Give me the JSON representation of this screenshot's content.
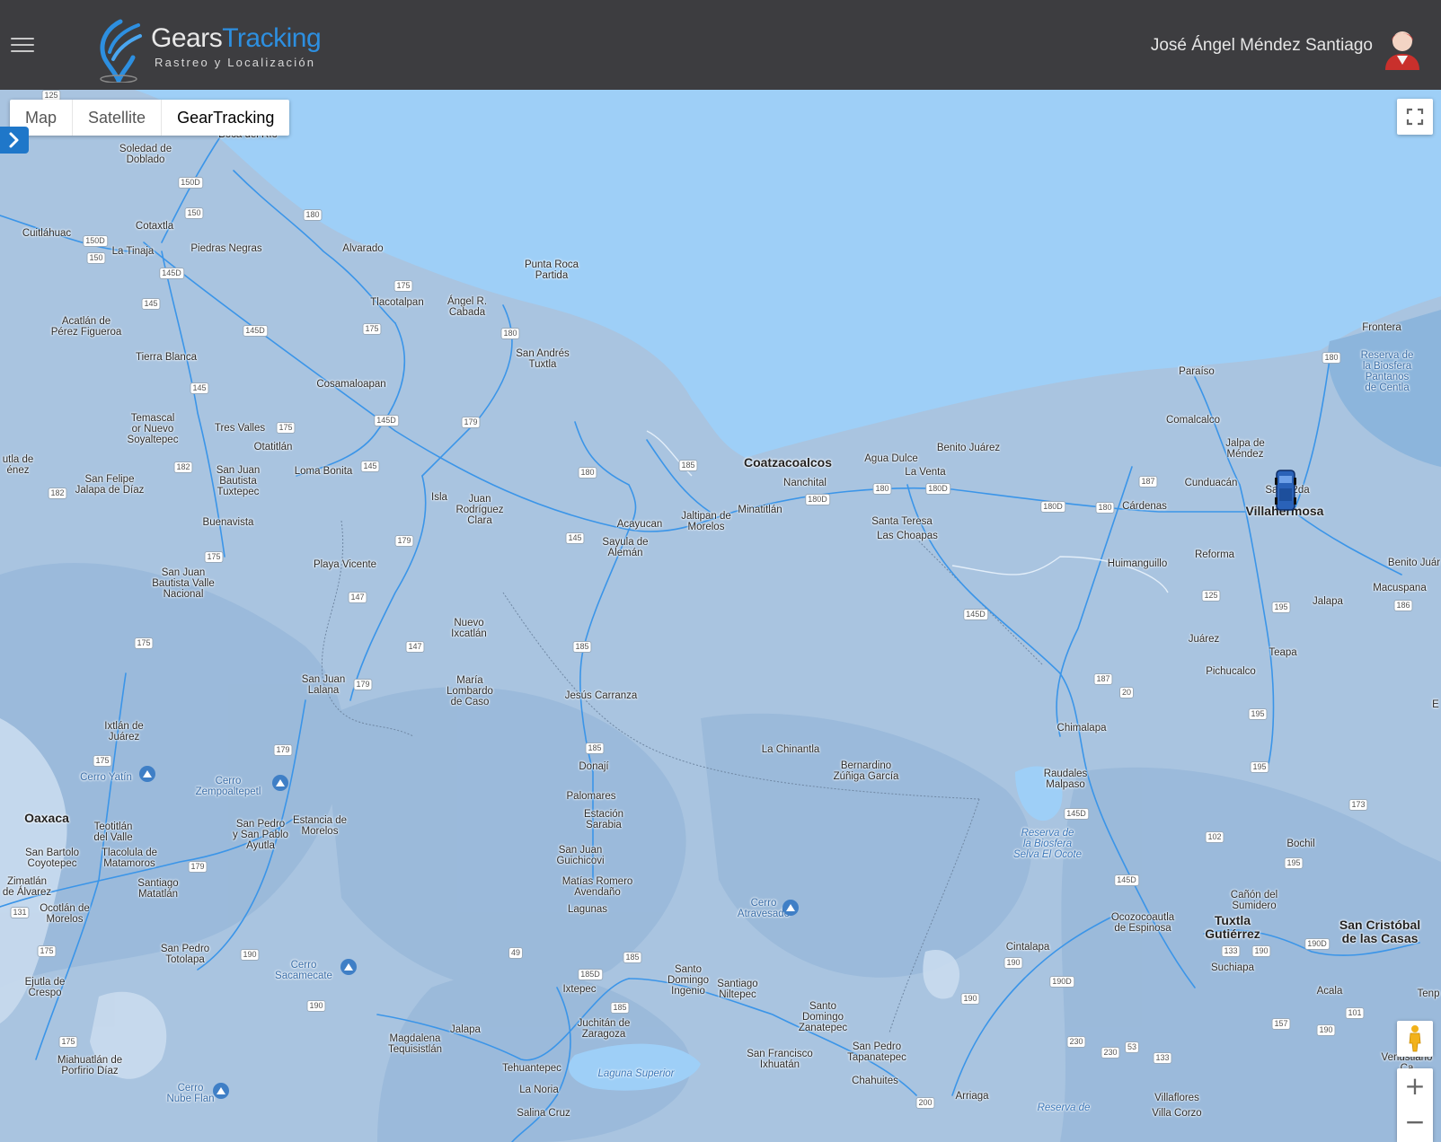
{
  "header": {
    "menu_icon": "hamburger-menu-icon",
    "logo_word1": "Gears",
    "logo_word2": "Tracking",
    "logo_tagline": "Rastreo y Localización",
    "user_name": "José Ángel Méndez Santiago",
    "avatar_icon": "user-avatar-icon"
  },
  "map_type": {
    "options": [
      "Map",
      "Satellite",
      "GearTracking"
    ],
    "selected": "GearTracking"
  },
  "controls": {
    "side_toggle_icon": "chevron-right-icon",
    "fullscreen_icon": "fullscreen-icon",
    "street_view_icon": "pegman-icon",
    "zoom_in": "+",
    "zoom_out": "−"
  },
  "colors": {
    "header_bg": "#3d3d40",
    "brand_blue": "#2d8fe0",
    "water": "#9ecff7",
    "land": "#a9c4e0",
    "road": "#3b95e8"
  },
  "places": {
    "boca_del_rio": "Boca del Río",
    "soledad": "Soledad de\nDoblado",
    "cotaxtla": "Cotaxtla",
    "cuitlahuac": "Cuitláhuac",
    "la_tinaja": "La Tinaja",
    "piedras_negras": "Piedras Negras",
    "alvarado": "Alvarado",
    "punta_roca": "Punta Roca\nPartida",
    "tlacotalpan": "Tlacotalpan",
    "angel_cabada": "Ángel R.\nCabada",
    "acatlan": "Acatlán de\nPérez Figueroa",
    "tierra_blanca": "Tierra Blanca",
    "san_andres": "San Andrés\nTuxtla",
    "cosamaloapan": "Cosamaloapan",
    "temascal": "Temascal\nor Nuevo\nSoyaltepec",
    "tres_valles": "Tres Valles",
    "otatitlan": "Otatitlán",
    "utla": "utla de\nénez",
    "san_felipe": "San Felipe\nJalapa de Díaz",
    "sj_tuxtepec": "San Juan\nBautista\nTuxtepec",
    "loma_bonita": "Loma Bonita",
    "isla": "Isla",
    "juan_rodriguez": "Juan\nRodríguez\nClara",
    "acayucan": "Acayucan",
    "sayula": "Sayula de\nAlemán",
    "jaltipan": "Jaltipan de\nMorelos",
    "minatitlan": "Minatitlán",
    "coatzacoalcos": "Coatzacoalcos",
    "nanchital": "Nanchital",
    "agua_dulce": "Agua Dulce",
    "la_venta": "La Venta",
    "benito_juarez": "Benito Juárez",
    "santa_teresa": "Santa Teresa",
    "las_choapas": "Las Choapas",
    "paraiso": "Paraíso",
    "comalcalco": "Comalcalco",
    "frontera": "Frontera",
    "centla": "Reserva de\nla Biosfera\nPantanos\nde Centla",
    "jalpa": "Jalpa de\nMéndez",
    "cunduacan": "Cunduacán",
    "cardenas": "Cárdenas",
    "villahermosa": "Villahermosa",
    "sa_2da": "Sa     2da",
    "buenavista": "Buenavista",
    "sj_valle": "San Juan\nBautista Valle\nNacional",
    "playa_vicente": "Playa Vicente",
    "nuevo_ixcatlan": "Nuevo\nIxcatlán",
    "maria_lombardo": "María\nLombardo\nde Caso",
    "jesus_carranza": "Jesús Carranza",
    "sj_lalana": "San Juan\nLalana",
    "huimanguillo": "Huimanguillo",
    "reforma": "Reforma",
    "benito_juarez2": "Benito Juár",
    "macuspana": "Macuspana",
    "jalapa_tab": "Jalapa",
    "juarez": "Juárez",
    "teapa": "Teapa",
    "pichucalco": "Pichucalco",
    "ixtlan": "Ixtlán de\nJuárez",
    "cerro_yatin": "Cerro Yatín",
    "cerro_zempoal": "Cerro\nZempoaltepetl",
    "la_chinantla": "La Chinantla",
    "bernardino": "Bernardino\nZúñiga García",
    "chimalapa": "Chimalapa",
    "raudales": "Raudales\nMalpaso",
    "donaji": "Donají",
    "palomares": "Palomares",
    "estacion_sarabia": "Estación\nSarabia",
    "oaxaca": "Oaxaca",
    "teotitlan": "Teotitlán\ndel Valle",
    "sp_ayutla": "San Pedro\ny San Pablo\nAyutla",
    "estancia": "Estancia de\nMorelos",
    "sj_guichicovi": "San Juan\nGuichicovi",
    "el_ocote": "Reserva de\nla Biosfera\nSelva El Ocote",
    "bochil": "Bochil",
    "sb_coyotepec": "San Bartolo\nCoyotepec",
    "tlacolula": "Tlacolula de\nMatamoros",
    "zimatlan": "Zimatlán\nde Álvarez",
    "santiago_matatlan": "Santiago\nMatatlán",
    "matias_romero": "Matías Romero\nAvendaño",
    "ocotlan": "Ocotlán de\nMorelos",
    "lagunas": "Lagunas",
    "cerro_atravesado": "Cerro\nAtravesado",
    "canon_sumidero": "Cañón del\nSumidero",
    "ocozocoautla": "Ocozocoautla\nde Espinosa",
    "tuxtla": "Tuxtla\nGutiérrez",
    "san_cristobal": "San Cristóbal\nde las Casas",
    "sp_totolapa": "San Pedro\nTotolapa",
    "cerro_sacamecate": "Cerro\nSacamecate",
    "ejutla": "Ejutla de\nCrespo",
    "cintalapa": "Cintalapa",
    "suchiapa": "Suchiapa",
    "ixtepec": "Ixtepec",
    "santo_domingo_ing": "Santo\nDomingo\nIngenio",
    "santiago_niltepec": "Santiago\nNiltepec",
    "acala": "Acala",
    "juchitan": "Juchitán de\nZaragoza",
    "santo_domingo_zan": "Santo\nDomingo\nZanatepec",
    "jalapa": "Jalapa",
    "magdalena": "Magdalena\nTequisistlán",
    "miahuatlan": "Miahuatlán de\nPorfirio Díaz",
    "sp_tapanatepec": "San Pedro\nTapanatepec",
    "sf_ixhuatan": "San Francisco\nIxhuatán",
    "tehuantepec": "Tehuantepec",
    "laguna_superior": "Laguna Superior",
    "cerro_nube": "Cerro\nNube Flan",
    "la_noria": "La Noria",
    "chahuites": "Chahuites",
    "arriaga": "Arriaga",
    "villaflores": "Villaflores",
    "venustiano": "Venustiano\nCa",
    "salina_cruz": "Salina Cruz",
    "villa_corzo": "Villa Corzo",
    "reserva_de": "Reserva de",
    "tenp": "Tenp",
    "e": "E"
  },
  "road_shields": [
    "125",
    "150D",
    "150",
    "180",
    "150D",
    "150",
    "145D",
    "175",
    "180",
    "145",
    "145D",
    "175",
    "145",
    "145D",
    "179",
    "175",
    "182",
    "145",
    "182",
    "180",
    "185",
    "180",
    "180D",
    "180",
    "180D",
    "180D",
    "180",
    "187",
    "180",
    "145",
    "179",
    "175",
    "147",
    "147",
    "175",
    "185",
    "179",
    "145D",
    "187",
    "20",
    "125",
    "195",
    "186",
    "179",
    "185",
    "195",
    "195",
    "175",
    "173",
    "145D",
    "102",
    "195",
    "179",
    "131",
    "175",
    "190",
    "190",
    "185",
    "49",
    "185D",
    "185",
    "145D",
    "190D",
    "133",
    "190",
    "190D",
    "190",
    "157",
    "190",
    "101",
    "230",
    "230",
    "53",
    "133",
    "175",
    "200",
    "190"
  ]
}
